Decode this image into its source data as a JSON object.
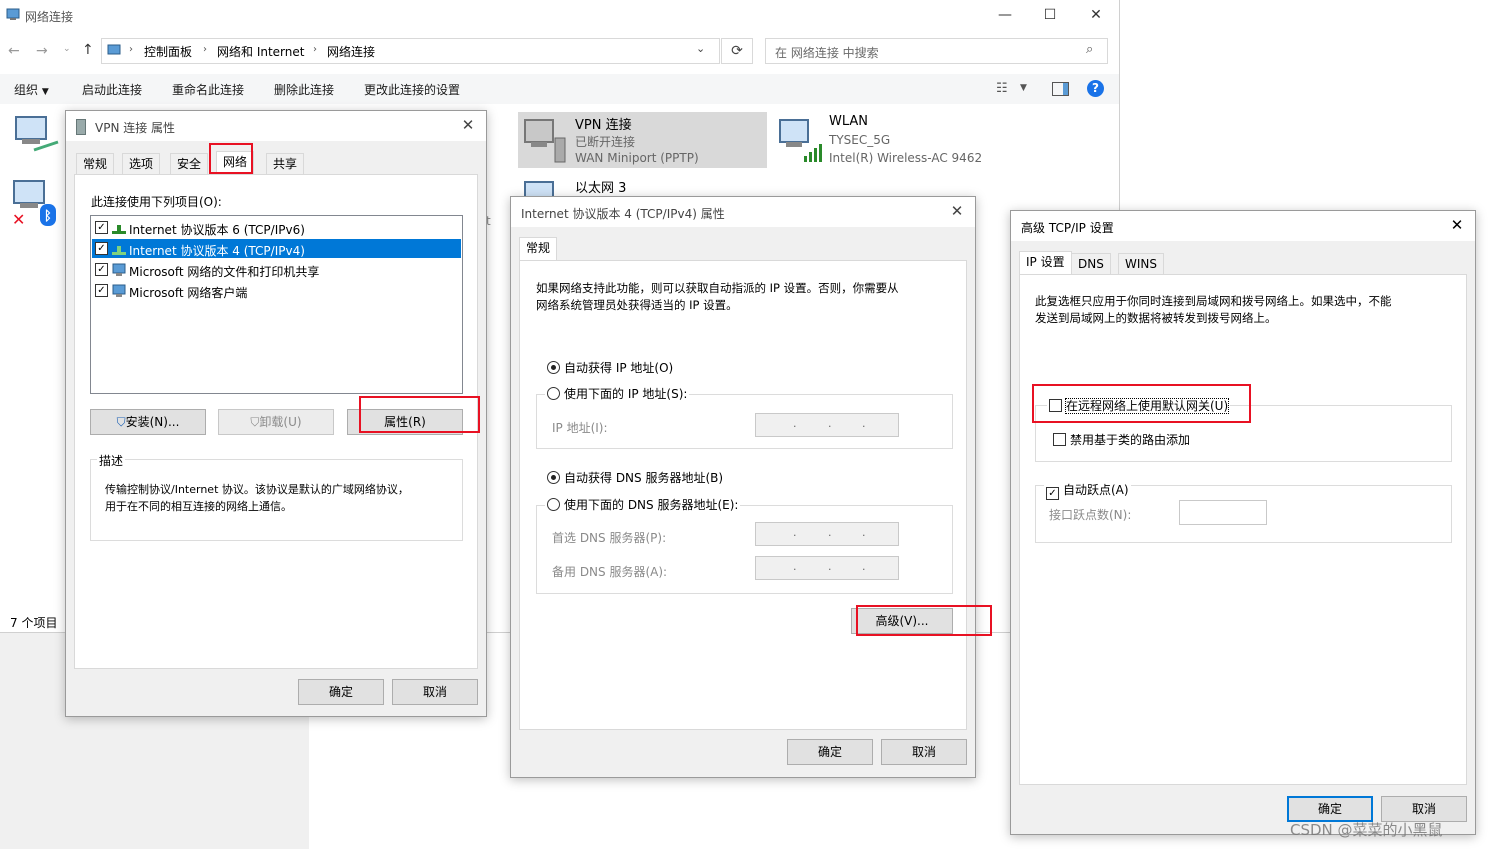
{
  "explorer": {
    "title": "网络连接",
    "controls": {
      "minimize": "—",
      "maximize": "☐",
      "close": "✕"
    },
    "breadcrumb": [
      "控制面板",
      "网络和 Internet",
      "网络连接"
    ],
    "search_placeholder": "在 网络连接 中搜索",
    "commands": [
      "组织",
      "启动此连接",
      "重命名此连接",
      "删除此连接",
      "更改此连接的设置"
    ],
    "items": [
      {
        "name": "VPN 连接",
        "status": "已断开连接",
        "device": "WAN Miniport (PPTP)"
      },
      {
        "name": "WLAN",
        "status": "TYSEC_5G",
        "device": "Intel(R) Wireless-AC 9462"
      },
      {
        "name": "以太网 3"
      }
    ],
    "partial_text": "t",
    "status_bar": "7 个项目"
  },
  "vpn_dialog": {
    "title": "VPN 连接 属性",
    "tabs": [
      "常规",
      "选项",
      "安全",
      "网络",
      "共享"
    ],
    "list_label": "此连接使用下列项目(O):",
    "items": [
      {
        "label": "Internet 协议版本 6 (TCP/IPv6)",
        "checked": true,
        "selected": false
      },
      {
        "label": "Internet 协议版本 4 (TCP/IPv4)",
        "checked": true,
        "selected": true
      },
      {
        "label": "Microsoft 网络的文件和打印机共享",
        "checked": true,
        "selected": false
      },
      {
        "label": "Microsoft 网络客户端",
        "checked": true,
        "selected": false
      }
    ],
    "install_btn": "安装(N)...",
    "uninstall_btn": "卸载(U)",
    "properties_btn": "属性(R)",
    "desc_title": "描述",
    "desc_text_1": "传输控制协议/Internet 协议。该协议是默认的广域网络协议，",
    "desc_text_2": "用于在不同的相互连接的网络上通信。",
    "ok": "确定",
    "cancel": "取消"
  },
  "ipv4_dialog": {
    "title": "Internet 协议版本 4 (TCP/IPv4) 属性",
    "tab": "常规",
    "intro_1": "如果网络支持此功能，则可以获取自动指派的 IP 设置。否则，你需要从",
    "intro_2": "网络系统管理员处获得适当的 IP 设置。",
    "auto_ip": "自动获得 IP 地址(O)",
    "manual_ip": "使用下面的 IP 地址(S):",
    "ip_label": "IP 地址(I):",
    "auto_dns": "自动获得 DNS 服务器地址(B)",
    "manual_dns": "使用下面的 DNS 服务器地址(E):",
    "pref_dns": "首选 DNS 服务器(P):",
    "alt_dns": "备用 DNS 服务器(A):",
    "advanced_btn": "高级(V)...",
    "ok": "确定",
    "cancel": "取消"
  },
  "adv_dialog": {
    "title": "高级 TCP/IP 设置",
    "tabs": [
      "IP 设置",
      "DNS",
      "WINS"
    ],
    "intro_1": "此复选框只应用于你同时连接到局域网和拨号网络上。如果选中，不能",
    "intro_2": "发送到局域网上的数据将被转发到拨号网络上。",
    "default_gateway": "在远程网络上使用默认网关(U)",
    "disable_class_route": "禁用基于类的路由添加",
    "auto_metric": "自动跃点(A)",
    "metric_label": "接口跃点数(N):",
    "ok": "确定",
    "cancel": "取消"
  },
  "watermark": "CSDN @菜菜的小黑鼠",
  "colors": {
    "selection": "#0078d7",
    "highlight": "#e81123",
    "link_blue": "#0078d7"
  }
}
